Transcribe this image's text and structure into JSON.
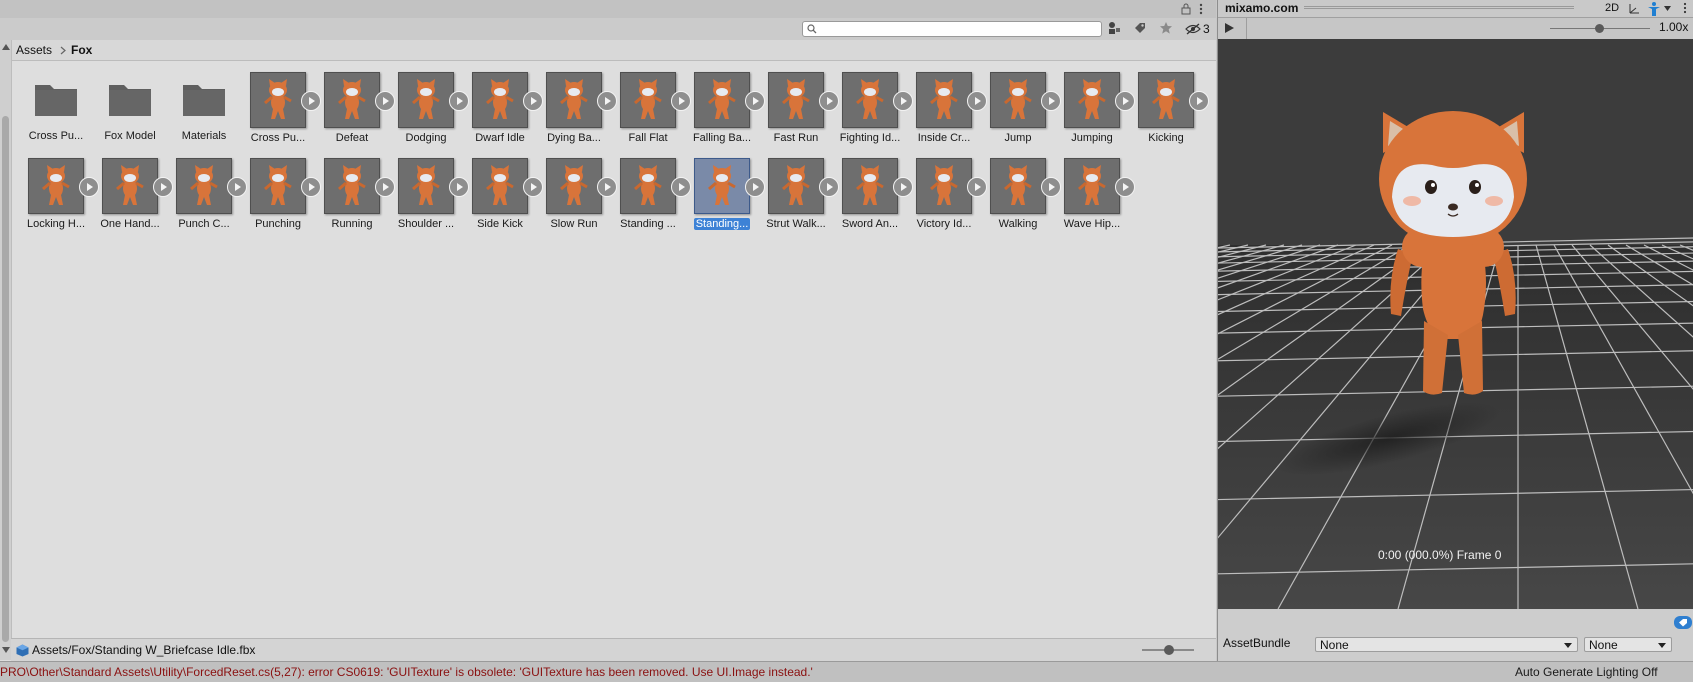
{
  "project": {
    "search": {
      "value": "",
      "placeholder": ""
    },
    "hidden_count": "3",
    "breadcrumb": [
      "Assets",
      "Fox"
    ],
    "row1": [
      {
        "label": "Cross Pu...",
        "type": "folder"
      },
      {
        "label": "Fox Model",
        "type": "folder"
      },
      {
        "label": "Materials",
        "type": "folder"
      },
      {
        "label": "Cross Pu...",
        "type": "anim"
      },
      {
        "label": "Defeat",
        "type": "anim"
      },
      {
        "label": "Dodging",
        "type": "anim"
      },
      {
        "label": "Dwarf Idle",
        "type": "anim"
      },
      {
        "label": "Dying Ba...",
        "type": "anim"
      },
      {
        "label": "Fall Flat",
        "type": "anim"
      },
      {
        "label": "Falling Ba...",
        "type": "anim"
      },
      {
        "label": "Fast Run",
        "type": "anim"
      },
      {
        "label": "Fighting Id...",
        "type": "anim"
      },
      {
        "label": "Inside Cr...",
        "type": "anim"
      },
      {
        "label": "Jump",
        "type": "anim"
      },
      {
        "label": "Jumping",
        "type": "anim"
      },
      {
        "label": "Kicking",
        "type": "anim"
      }
    ],
    "row2": [
      {
        "label": "Locking H...",
        "type": "anim"
      },
      {
        "label": "One Hand...",
        "type": "anim"
      },
      {
        "label": "Punch C...",
        "type": "anim"
      },
      {
        "label": "Punching",
        "type": "anim"
      },
      {
        "label": "Running",
        "type": "anim"
      },
      {
        "label": "Shoulder ...",
        "type": "anim"
      },
      {
        "label": "Side Kick",
        "type": "anim"
      },
      {
        "label": "Slow Run",
        "type": "anim"
      },
      {
        "label": "Standing ...",
        "type": "anim"
      },
      {
        "label": "Standing...",
        "type": "anim",
        "selected": true
      },
      {
        "label": "Strut Walk...",
        "type": "anim"
      },
      {
        "label": "Sword An...",
        "type": "anim"
      },
      {
        "label": "Victory Id...",
        "type": "anim"
      },
      {
        "label": "Walking",
        "type": "anim"
      },
      {
        "label": "Wave Hip...",
        "type": "anim"
      }
    ],
    "footer_path": "Assets/Fox/Standing W_Briefcase Idle.fbx"
  },
  "preview": {
    "title": "mixamo.com",
    "mode_2d": "2D",
    "speed": "1.00x",
    "time_readout": "0:00 (000.0%) Frame 0",
    "assetbundle_label": "AssetBundle",
    "assetbundle_value": "None",
    "variant_value": "None"
  },
  "status": {
    "error": "PRO\\Other\\Standard Assets\\Utility\\ForcedReset.cs(5,27): error CS0619: 'GUITexture' is obsolete: 'GUITexture has been removed. Use UI.Image instead.'",
    "lighting": "Auto Generate Lighting Off"
  },
  "colors": {
    "selection": "#3d82d6",
    "error_text": "#8a1010",
    "fox": "#d8743a"
  }
}
